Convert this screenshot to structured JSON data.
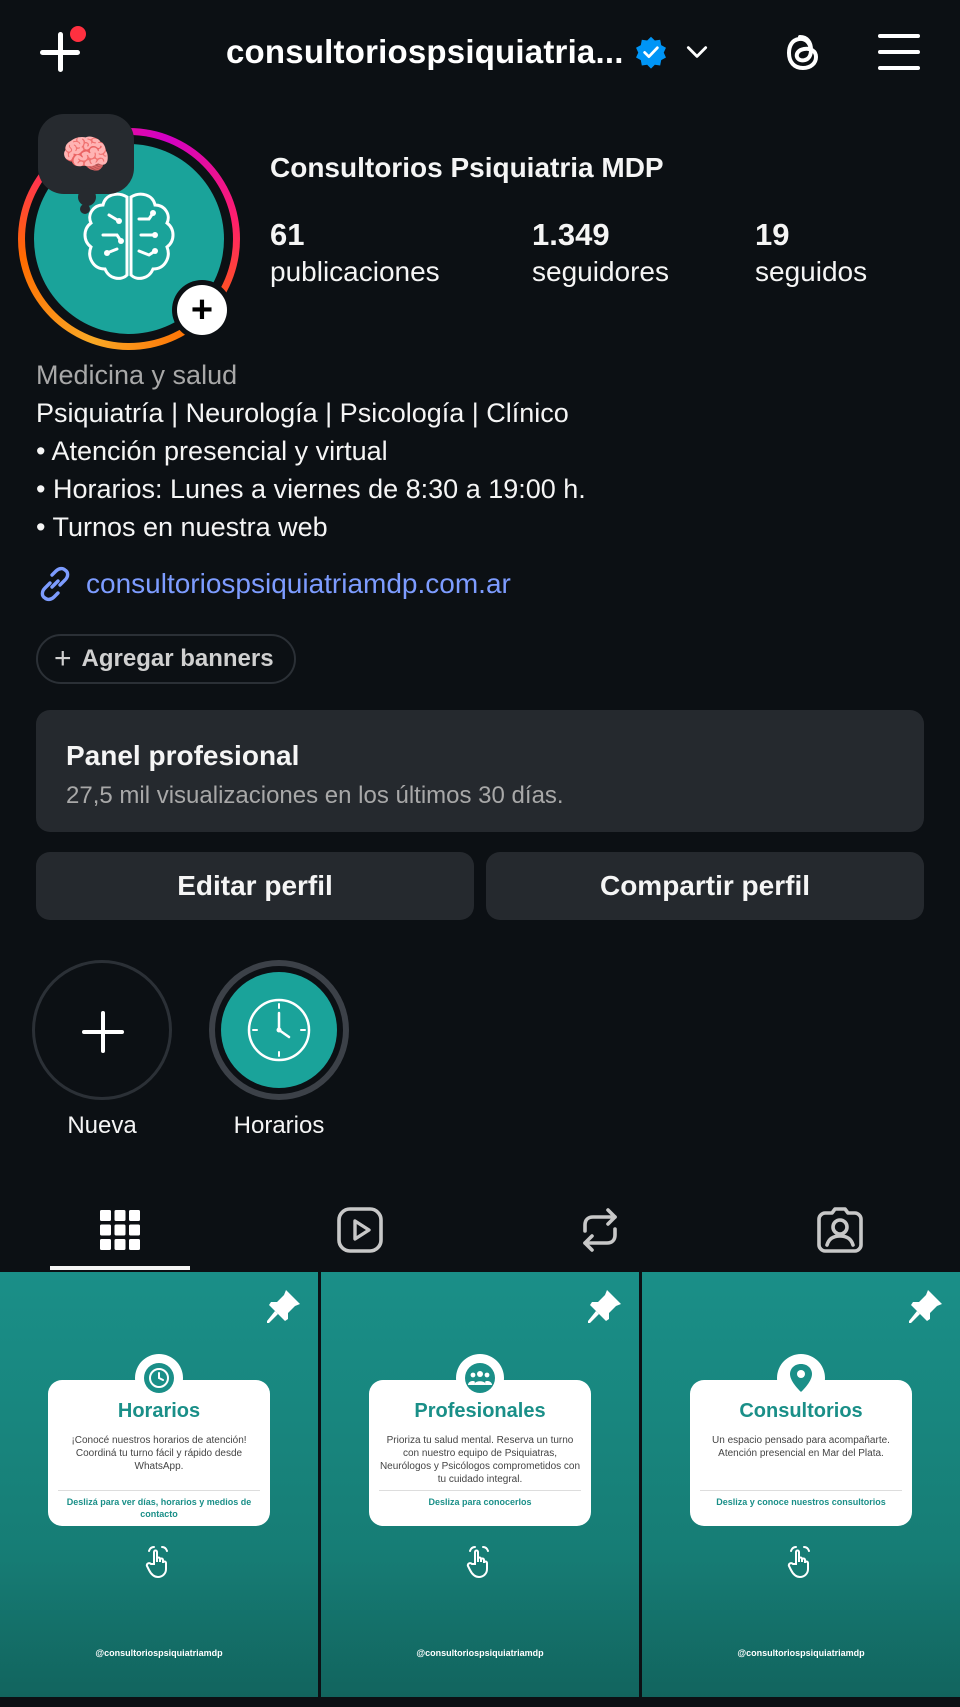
{
  "topbar": {
    "username": "consultoriospsiquiatria...",
    "create_icon": "plus-icon",
    "verified_icon": "verified-badge-icon",
    "threads_icon": "threads-icon",
    "menu_icon": "hamburger-menu-icon"
  },
  "profile": {
    "note_emoji": "🧠",
    "display_name": "Consultorios Psiquiatria MDP",
    "stats": [
      {
        "value": "61",
        "label": "publicaciones"
      },
      {
        "value": "1.349",
        "label": "seguidores"
      },
      {
        "value": "19",
        "label": "seguidos"
      }
    ],
    "category": "Medicina y salud",
    "bio": [
      "Psiquiatría | Neurología | Psicología | Clínico",
      "• Atención presencial y virtual",
      "• Horarios: Lunes a viernes de 8:30 a 19:00 h.",
      "• Turnos en nuestra web"
    ],
    "link": "consultoriospsiquiatriamdp.com.ar",
    "add_banners": "Agregar banners"
  },
  "panel": {
    "title": "Panel profesional",
    "subtitle": "27,5 mil visualizaciones en los últimos 30 días."
  },
  "actions": {
    "edit": "Editar perfil",
    "share": "Compartir perfil"
  },
  "highlights": [
    {
      "label": "Nueva"
    },
    {
      "label": "Horarios"
    }
  ],
  "tabs": [
    "grid-icon",
    "reels-icon",
    "reposts-icon",
    "tagged-icon"
  ],
  "posts": [
    {
      "title": "Horarios",
      "body": "¡Conocé nuestros horarios de atención! Coordiná tu turno fácil y rápido desde WhatsApp.",
      "cta": "Deslizá para ver días, horarios y medios de contacto",
      "handle": "@consultoriospsiquiatriamdp"
    },
    {
      "title": "Profesionales",
      "body": "Prioriza tu salud mental. Reserva un turno con nuestro equipo de Psiquiatras, Neurólogos y Psicólogos comprometidos con tu cuidado integral.",
      "cta": "Desliza para conocerlos",
      "handle": "@consultoriospsiquiatriamdp"
    },
    {
      "title": "Consultorios",
      "body": "Un espacio pensado para acompañarte. Atención presencial en Mar del Plata.",
      "cta": "Desliza y conoce nuestros consultorios",
      "handle": "@consultoriospsiquiatriamdp"
    }
  ],
  "colors": {
    "background": "#0c1014",
    "surface": "#25292e",
    "link": "#7d9cff",
    "brand_teal": "#1aa39a",
    "verified": "#0095f6",
    "notification": "#ff3040"
  }
}
